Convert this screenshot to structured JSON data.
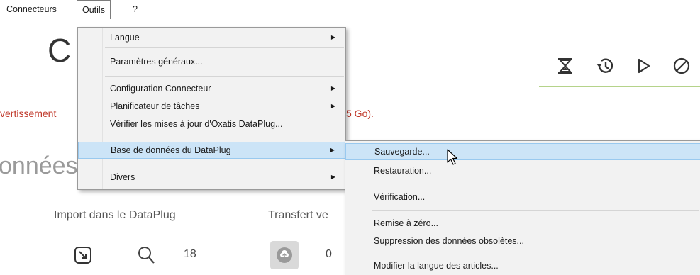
{
  "menubar": {
    "connecteurs": "Connecteurs",
    "outils": "Outils",
    "help": "?"
  },
  "app": {
    "big_letter": "C",
    "warning_left": "vertissement",
    "warning_right": "5 Go).",
    "section_title": "onnées",
    "import_label": "Import dans le DataPlug",
    "transfert_label": "Transfert ve",
    "count_1": "18",
    "count_2": "0"
  },
  "toolbar_icons": [
    "hourglass-icon",
    "history-icon",
    "play-icon",
    "cancel-icon"
  ],
  "outils_menu": {
    "items": [
      {
        "label": "Langue",
        "submenu": true
      },
      {
        "label": "Paramètres généraux...",
        "submenu": false
      },
      {
        "label": "Configuration Connecteur",
        "submenu": true
      },
      {
        "label": "Planificateur de tâches",
        "submenu": true
      },
      {
        "label": "Vérifier les mises à jour d'Oxatis DataPlug...",
        "submenu": false
      },
      {
        "label": "Base de données du DataPlug",
        "submenu": true,
        "highlighted": true
      },
      {
        "label": "Divers",
        "submenu": true
      }
    ]
  },
  "base_submenu": {
    "items": [
      {
        "label": "Sauvegarde...",
        "highlighted": true
      },
      {
        "label": "Restauration..."
      },
      {
        "label": "Vérification..."
      },
      {
        "label": "Remise à zéro..."
      },
      {
        "label": "Suppression des données obsolètes..."
      },
      {
        "label": "Modifier la langue des articles..."
      }
    ]
  },
  "colors": {
    "highlight": "#cce4f7",
    "highlight_border": "#99c9ef",
    "warning": "#c0392b",
    "accent_line": "#b5d38a"
  }
}
